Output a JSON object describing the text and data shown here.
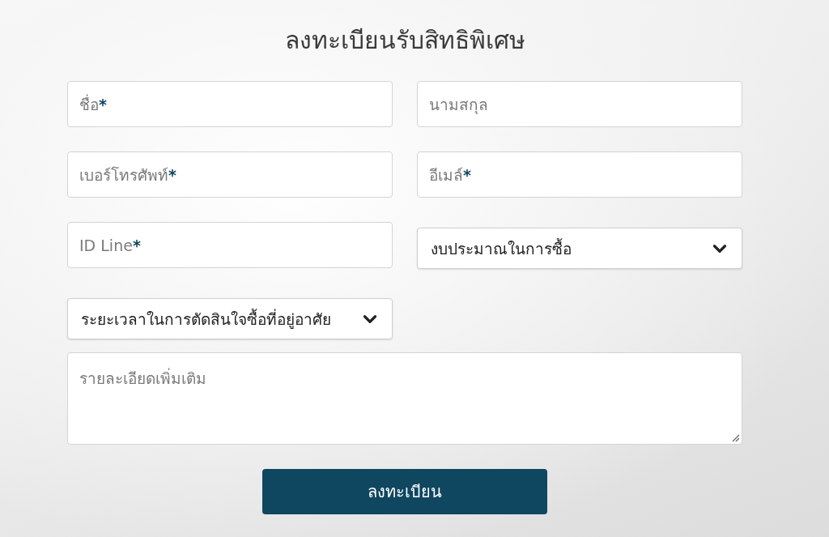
{
  "title": "ลงทะเบียนรับสิทธิพิเศษ",
  "fields": [
    {
      "kind": "input",
      "placeholder": "ชื่อ",
      "required_mark": "*"
    },
    {
      "kind": "input",
      "placeholder": "นามสกุล"
    },
    {
      "kind": "input",
      "placeholder": "เบอร์โทรศัพท์",
      "required_mark": "*"
    },
    {
      "kind": "input",
      "placeholder": "อีเมล์",
      "required_mark": "*"
    },
    {
      "kind": "input",
      "placeholder": "ID Line",
      "required_mark": "*"
    },
    {
      "kind": "select",
      "value": "งบประมาณในการซื้อ"
    },
    {
      "kind": "select",
      "value": "ระยะเวลาในการตัดสินใจซื้อที่อยู่อาศัย"
    },
    {
      "kind": "textarea",
      "placeholder": "รายละเอียดเพิ่มเติม"
    }
  ],
  "submit_button": {
    "label": "ลงทะเบียน"
  }
}
